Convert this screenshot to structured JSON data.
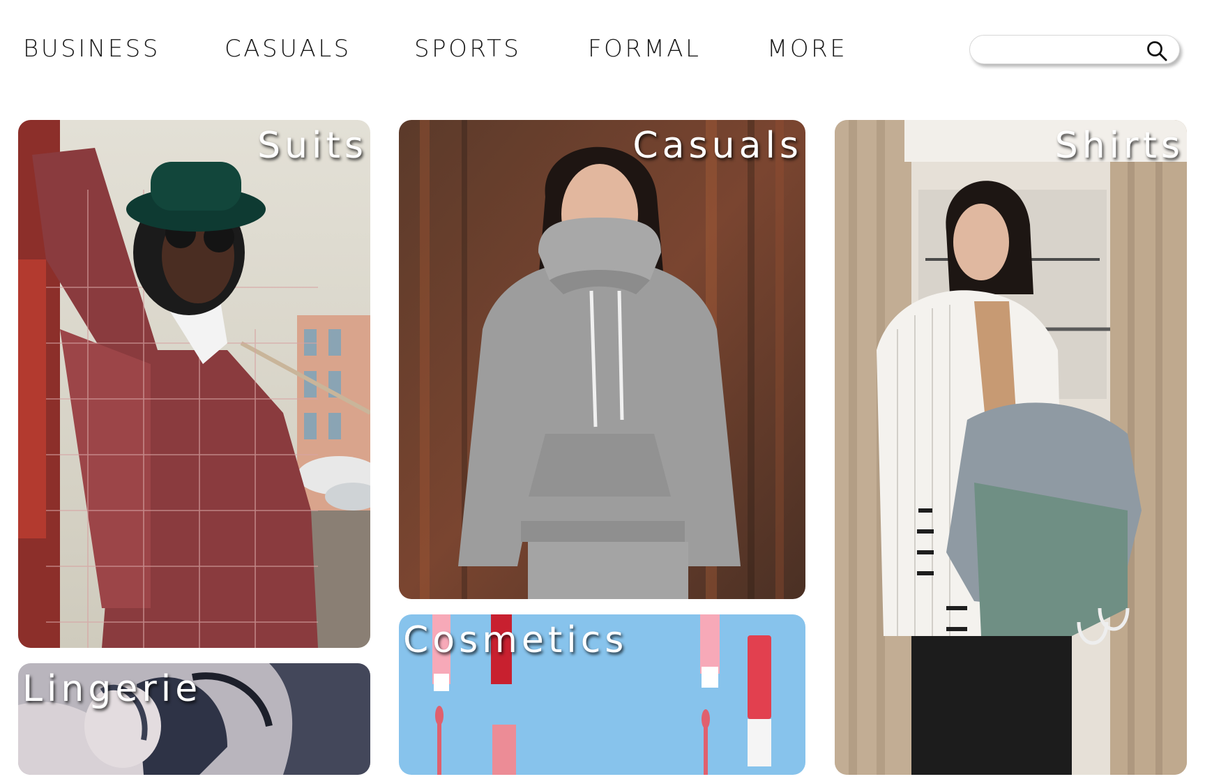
{
  "nav": {
    "items": [
      {
        "label": "BUSINESS"
      },
      {
        "label": "CASUALS"
      },
      {
        "label": "SPORTS"
      },
      {
        "label": "FORMAL"
      },
      {
        "label": "MORE"
      }
    ]
  },
  "search": {
    "value": "",
    "placeholder": "",
    "icon": "search-icon"
  },
  "cards": {
    "suits": {
      "label": "Suits"
    },
    "lingerie": {
      "label": "Lingerie"
    },
    "casuals": {
      "label": "Casuals"
    },
    "cosmetics": {
      "label": "Cosmetics"
    },
    "shirts": {
      "label": "Shirts"
    }
  },
  "colors": {
    "nav_text": "#1a1a1a",
    "label_text": "#ffffff",
    "background": "#ffffff"
  }
}
